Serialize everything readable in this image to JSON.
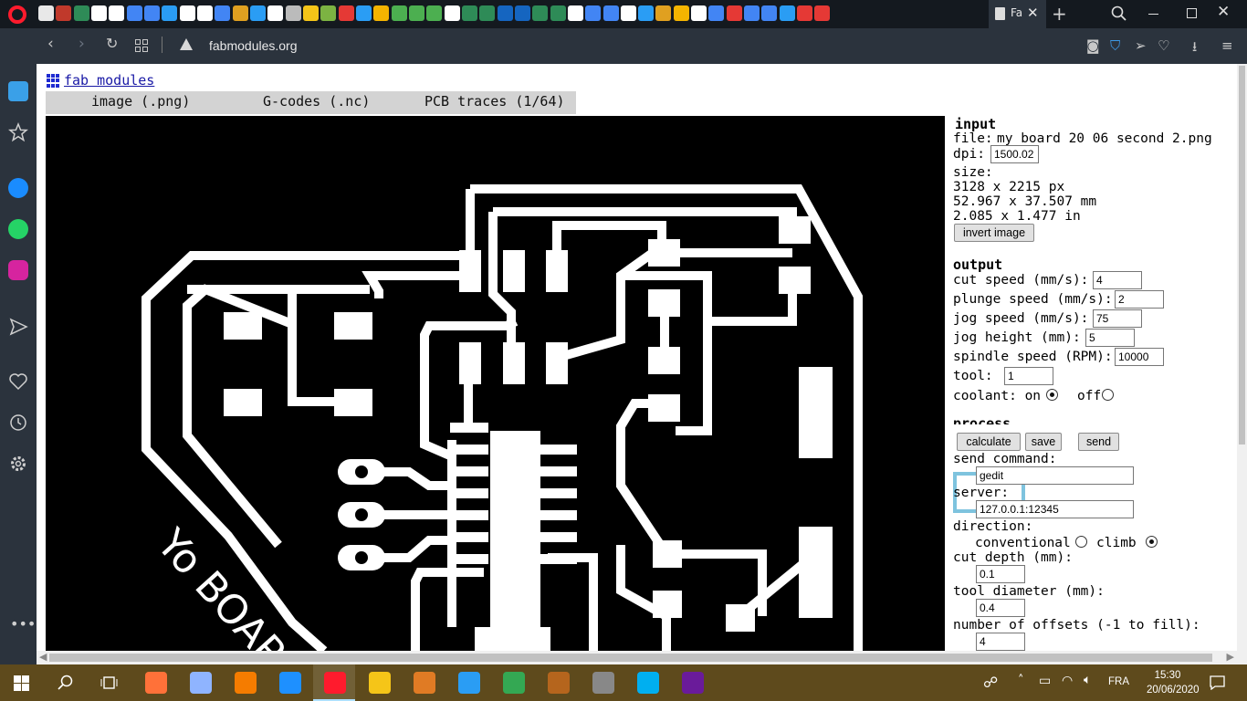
{
  "browser": {
    "active_tab_title": "Fa",
    "url": "fabmodules.org",
    "tab_favicons": [
      "#e8e8e8",
      "#c0392b",
      "#2e8b57",
      "#ffffff",
      "#ffffff",
      "#4285f4",
      "#4285f4",
      "#2a9df4",
      "#ffffff",
      "#ffffff",
      "#4285f4",
      "#e0a020",
      "#2a9df4",
      "#ffffff",
      "#bbbbbb",
      "#f5c518",
      "#7cb342",
      "#e53935",
      "#2a9df4",
      "#f4b400",
      "#4caf50",
      "#4caf50",
      "#4caf50",
      "#ffffff",
      "#2e8b57",
      "#2e8b57",
      "#1565c0",
      "#1565c0",
      "#2e8b57",
      "#2e8b57",
      "#ffffff",
      "#4285f4",
      "#4285f4",
      "#ffffff",
      "#2a9df4",
      "#e0a020",
      "#f4b400",
      "#ffffff",
      "#4285f4",
      "#e53935",
      "#4285f4",
      "#4285f4",
      "#2a9df4",
      "#e53935",
      "#e53935"
    ]
  },
  "page": {
    "logo_text": "fab modules",
    "menu": {
      "image": "image (.png)",
      "gcodes": "G-codes (.nc)",
      "pcb": "PCB traces (1/64)"
    }
  },
  "panel": {
    "input": {
      "heading": "input",
      "file_label": "file:",
      "file_name": "my board 20 06 second 2.png",
      "dpi_label": "dpi:",
      "dpi_value": "1500.02",
      "size_label": "size:",
      "size_px": "3128 x 2215 px",
      "size_mm": "52.967 x 37.507 mm",
      "size_in": "2.085 x 1.477 in",
      "invert_button": "invert image"
    },
    "output": {
      "heading": "output",
      "cut_speed_label": "cut speed (mm/s):",
      "cut_speed": "4",
      "plunge_speed_label": "plunge speed (mm/s):",
      "plunge_speed": "2",
      "jog_speed_label": "jog speed (mm/s):",
      "jog_speed": "75",
      "jog_height_label": "jog height (mm):",
      "jog_height": "5",
      "spindle_label": "spindle speed (RPM):",
      "spindle": "10000",
      "tool_label": "tool:",
      "tool": "1",
      "coolant_label": "coolant: on",
      "coolant_off_label": "off",
      "coolant": "on"
    },
    "process": {
      "heading": "process",
      "calculate": "calculate",
      "save": "save",
      "send": "send",
      "send_command_label": "send command:",
      "send_command": "gedit",
      "server_label": "server:",
      "server": "127.0.0.1:12345",
      "direction_label": "direction:",
      "conventional_label": "conventional",
      "climb_label": "climb",
      "direction": "climb",
      "cut_depth_label": "cut depth (mm):",
      "cut_depth": "0.1",
      "tool_diameter_label": "tool diameter (mm):",
      "tool_diameter": "0.4",
      "offsets_label": "number of offsets (-1 to fill):",
      "offsets": "4"
    }
  },
  "pcb_image": {
    "board_text": "Yo BOARD"
  },
  "taskbar": {
    "time": "15:30",
    "date": "20/06/2020",
    "language": "FRA",
    "apps": [
      "#ff7139",
      "#8fb4ff",
      "#f57c00",
      "#1e90ff",
      "#ff1b2d",
      "#f5c518",
      "#e07b24",
      "#2a9df4",
      "#34a853",
      "#b5651d",
      "#888888",
      "#00aff0",
      "#6a1b9a"
    ]
  }
}
